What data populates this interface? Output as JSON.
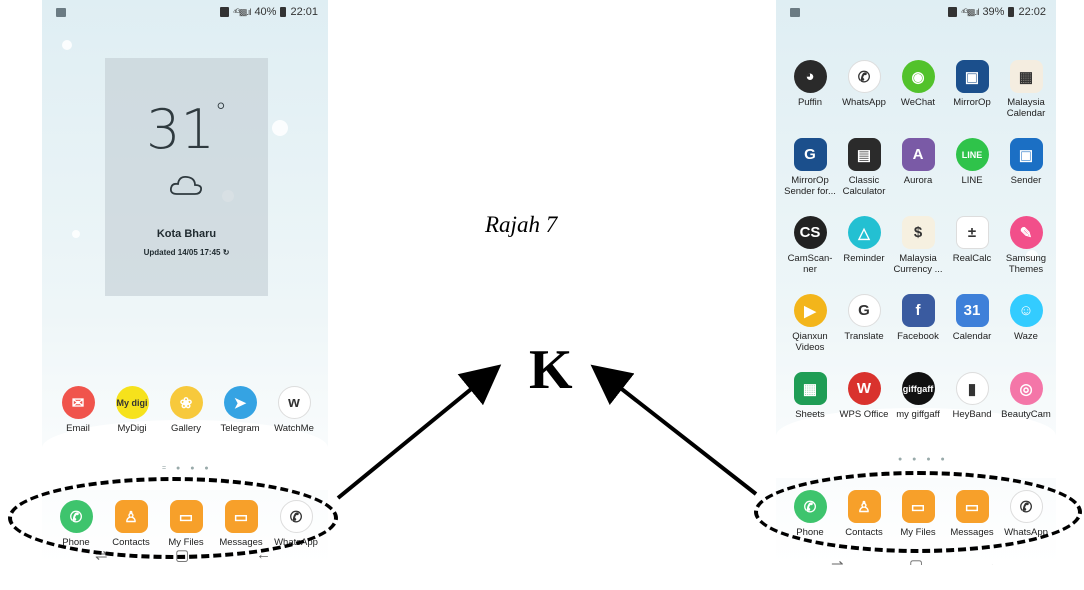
{
  "figure": {
    "caption": "Rajah 7",
    "center_label": "K"
  },
  "left_phone": {
    "status": {
      "battery": "40%",
      "time": "22:01"
    },
    "weather": {
      "temperature": "31",
      "degree": "°",
      "city": "Kota Bharu",
      "updated": "Updated 14/05 17:45"
    },
    "apps": [
      {
        "label": "Email",
        "color": "#f0544c",
        "glyph": "✉"
      },
      {
        "label": "MyDigi",
        "color": "#f6e21c",
        "glyph": "My digi"
      },
      {
        "label": "Gallery",
        "color": "#f7c93c",
        "glyph": "❀"
      },
      {
        "label": "Telegram",
        "color": "#35a3e3",
        "glyph": "➤"
      },
      {
        "label": "WatchMe",
        "color": "#ffffff",
        "glyph": "w"
      }
    ],
    "dock": [
      {
        "label": "Phone",
        "color": "#3ec46d",
        "glyph": "✆"
      },
      {
        "label": "Contacts",
        "color": "#f7a02a",
        "glyph": "♙"
      },
      {
        "label": "My Files",
        "color": "#f7a02a",
        "glyph": "▭"
      },
      {
        "label": "Messages",
        "color": "#f7a02a",
        "glyph": "▭"
      },
      {
        "label": "WhatsApp",
        "color": "#ffffff",
        "glyph": "✆"
      }
    ]
  },
  "right_phone": {
    "status": {
      "battery": "39%",
      "time": "22:02"
    },
    "apps": [
      {
        "label": "Puffin",
        "color": "#2a2a2a",
        "glyph": "◕"
      },
      {
        "label": "WhatsApp",
        "color": "#ffffff",
        "glyph": "✆"
      },
      {
        "label": "WeChat",
        "color": "#52c22b",
        "glyph": "◉"
      },
      {
        "label": "MirrorOp",
        "color": "#1b4f8c",
        "glyph": "▣"
      },
      {
        "label": "Malaysia Calendar",
        "color": "#f4ede0",
        "glyph": "▦"
      },
      {
        "label": "MirrorOp Sender for...",
        "color": "#1b4f8c",
        "glyph": "G"
      },
      {
        "label": "Classic Calculator",
        "color": "#2b2b2b",
        "glyph": "▤"
      },
      {
        "label": "Aurora",
        "color": "#7a5aa6",
        "glyph": "A"
      },
      {
        "label": "LINE",
        "color": "#2fc34a",
        "glyph": "LINE"
      },
      {
        "label": "Sender",
        "color": "#1b6fc4",
        "glyph": "▣"
      },
      {
        "label": "CamScan-ner",
        "color": "#222222",
        "glyph": "CS"
      },
      {
        "label": "Reminder",
        "color": "#23c0d2",
        "glyph": "△"
      },
      {
        "label": "Malaysia Currency ...",
        "color": "#f6f0e0",
        "glyph": "$"
      },
      {
        "label": "RealCalc",
        "color": "#ffffff",
        "glyph": "±"
      },
      {
        "label": "Samsung Themes",
        "color": "#f24f8a",
        "glyph": "✎"
      },
      {
        "label": "Qianxun Videos",
        "color": "#f3b51b",
        "glyph": "▶"
      },
      {
        "label": "Translate",
        "color": "#ffffff",
        "glyph": "G"
      },
      {
        "label": "Facebook",
        "color": "#3a5ba0",
        "glyph": "f"
      },
      {
        "label": "Calendar",
        "color": "#3e80d9",
        "glyph": "31"
      },
      {
        "label": "Waze",
        "color": "#33ccff",
        "glyph": "☺"
      },
      {
        "label": "Sheets",
        "color": "#1f9d55",
        "glyph": "▦"
      },
      {
        "label": "WPS Office",
        "color": "#d9322d",
        "glyph": "W"
      },
      {
        "label": "my giffgaff",
        "color": "#111111",
        "glyph": "giffgaff"
      },
      {
        "label": "HeyBand",
        "color": "#ffffff",
        "glyph": "▮"
      },
      {
        "label": "BeautyCam",
        "color": "#f476a8",
        "glyph": "◎"
      }
    ],
    "dock": [
      {
        "label": "Phone",
        "color": "#3ec46d",
        "glyph": "✆"
      },
      {
        "label": "Contacts",
        "color": "#f7a02a",
        "glyph": "♙"
      },
      {
        "label": "My Files",
        "color": "#f7a02a",
        "glyph": "▭"
      },
      {
        "label": "Messages",
        "color": "#f7a02a",
        "glyph": "▭"
      },
      {
        "label": "WhatsApp",
        "color": "#ffffff",
        "glyph": "✆"
      }
    ]
  }
}
